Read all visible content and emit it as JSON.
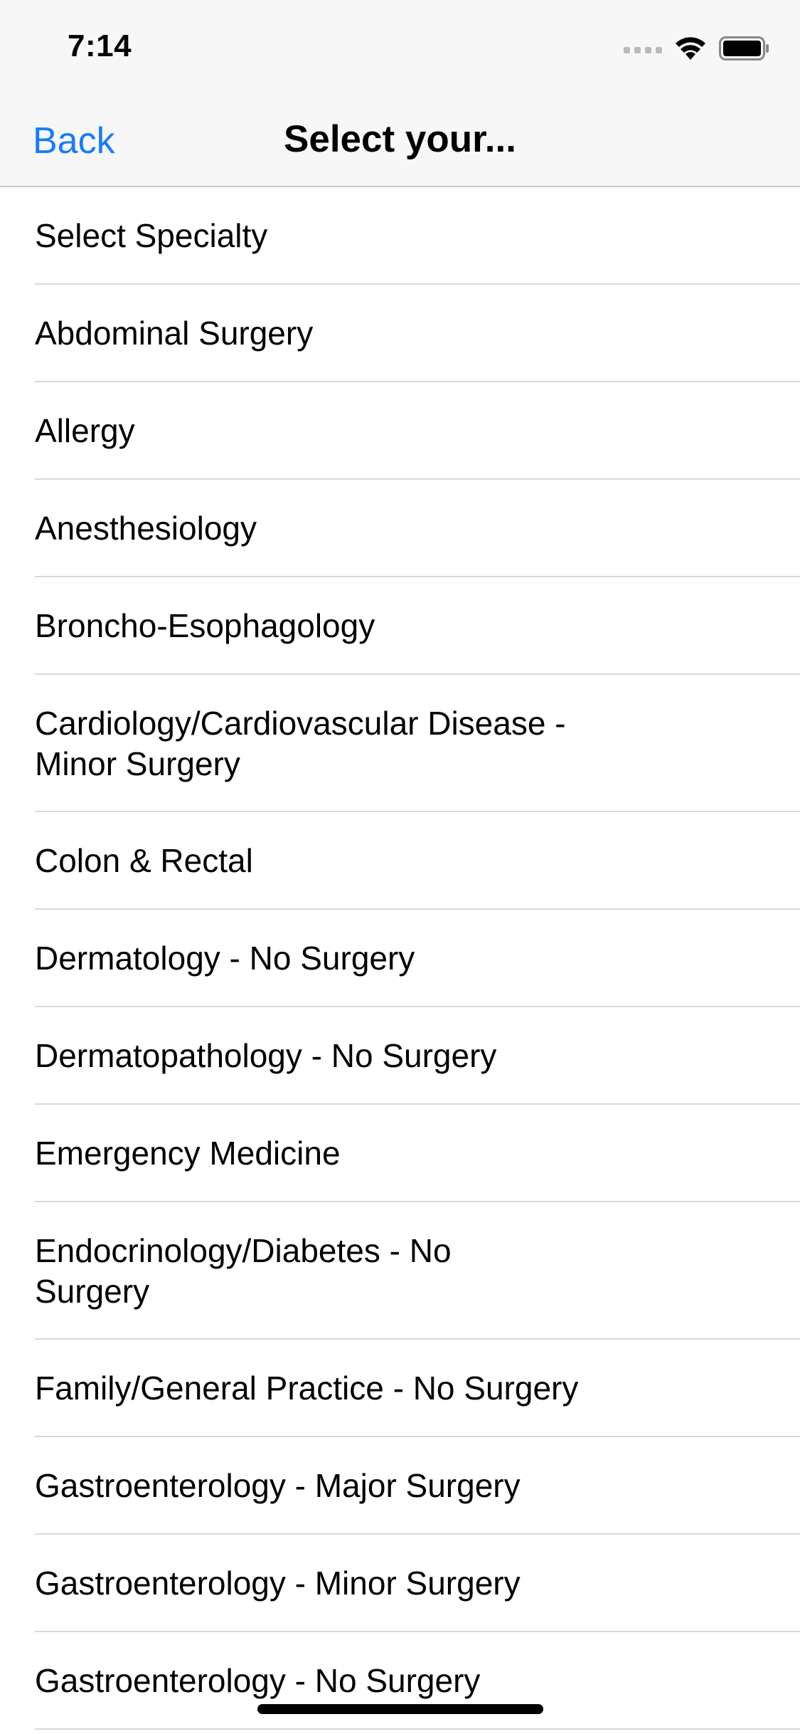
{
  "status_bar": {
    "time": "7:14",
    "icons": [
      "signal-dots-icon",
      "wifi-icon",
      "battery-icon"
    ]
  },
  "nav": {
    "back_label": "Back",
    "title": "Select your..."
  },
  "colors": {
    "accent": "#1a7cf5",
    "separator": "#d8d8dc",
    "header_bg": "#f7f7f7"
  },
  "list": {
    "items": [
      {
        "label": "Select Specialty"
      },
      {
        "label": "Abdominal Surgery"
      },
      {
        "label": "Allergy"
      },
      {
        "label": "Anesthesiology"
      },
      {
        "label": "Broncho-Esophagology"
      },
      {
        "label": "Cardiology/Cardiovascular Disease - Minor Surgery"
      },
      {
        "label": "Colon & Rectal"
      },
      {
        "label": "Dermatology - No Surgery"
      },
      {
        "label": "Dermatopathology - No Surgery"
      },
      {
        "label": "Emergency Medicine"
      },
      {
        "label": "Endocrinology/Diabetes - No Surgery"
      },
      {
        "label": "Family/General Practice - No Surgery"
      },
      {
        "label": "Gastroenterology - Major Surgery"
      },
      {
        "label": "Gastroenterology - Minor Surgery"
      },
      {
        "label": "Gastroenterology - No Surgery"
      }
    ]
  }
}
